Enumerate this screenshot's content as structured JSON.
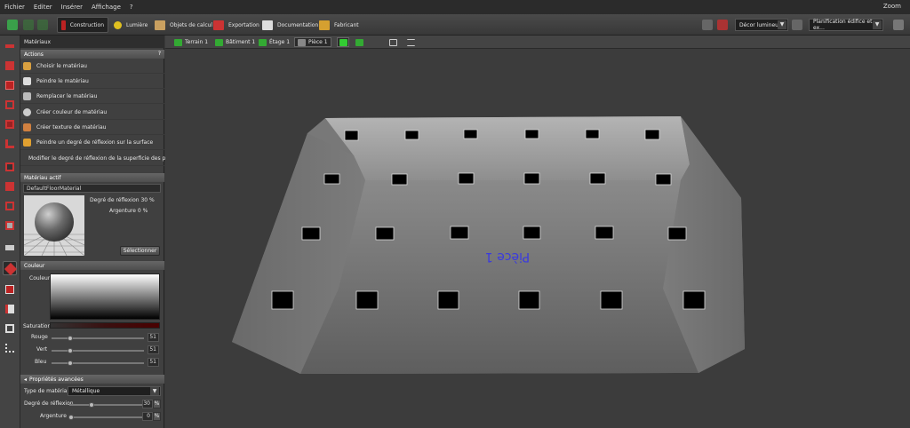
{
  "menu": {
    "items": [
      "Fichier",
      "Editer",
      "Insérer",
      "Affichage",
      "?"
    ],
    "zoom": "Zoom"
  },
  "toolbar": {
    "tabs": [
      "Construction",
      "Lumière",
      "Objets de calcul",
      "Exportation",
      "Documentation",
      "Fabricant"
    ],
    "light_scene": "Décor lumineux 1",
    "planning": "Planification édifice et ex..."
  },
  "breadcrumb": [
    "Terrain 1",
    "Bâtiment 1",
    "Étage 1",
    "Pièce 1"
  ],
  "panel": {
    "title": "Matériaux",
    "actions_header": "Actions",
    "help": "?",
    "actions": [
      "Choisir le matériau",
      "Peindre le matériau",
      "Remplacer le matériau",
      "Créer couleur de matériau",
      "Créer texture de matériau",
      "Peindre un degré de réflexion sur la surface",
      "Modifier le degré de réflexion de la superficie des pièce"
    ],
    "active_header": "Matériau actif",
    "material_name": "DefaultFloorMaterial",
    "reflection_label": "Degré de réflexion  30 %",
    "silver_label": "Argenture  0 %",
    "select_button": "Sélectionner",
    "color_header": "Couleur",
    "color_label": "Couleur",
    "saturation_label": "Saturation",
    "rgb": [
      {
        "label": "Rouge",
        "value": "51"
      },
      {
        "label": "Vert",
        "value": "51"
      },
      {
        "label": "Bleu",
        "value": "51"
      }
    ],
    "advanced_header": "Propriétés avancées",
    "material_type_label": "Type de matériau",
    "material_type_value": "Métallique",
    "reflection_field_label": "Degré de réflexion",
    "reflection_value": "30",
    "silver_field_label": "Argenture",
    "silver_value": "0",
    "percent": "%"
  },
  "viewport": {
    "room_label": "Pièce 1"
  }
}
